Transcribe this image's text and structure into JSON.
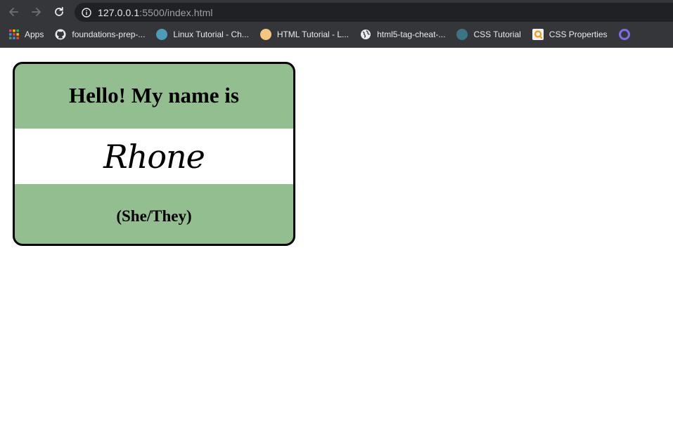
{
  "browser": {
    "url_host": "127.0.0.1",
    "url_rest": ":5500/index.html",
    "bookmarks": [
      {
        "label": "Apps",
        "icon": "apps-grid-icon"
      },
      {
        "label": "foundations-prep-...",
        "icon": "github-icon"
      },
      {
        "label": "Linux Tutorial - Ch...",
        "icon": "site-favicon-teal"
      },
      {
        "label": "HTML Tutorial - L...",
        "icon": "site-favicon-orange"
      },
      {
        "label": "html5-tag-cheat-...",
        "icon": "globe-icon"
      },
      {
        "label": "CSS Tutorial",
        "icon": "site-favicon-teal"
      },
      {
        "label": "CSS Properties",
        "icon": "site-favicon-search"
      }
    ]
  },
  "name_tag": {
    "greeting": "Hello! My name is",
    "name": "Rhone",
    "pronouns": "(She/They)",
    "colors": {
      "band": "#93bf90",
      "middle": "#ffffff",
      "border": "#000000"
    }
  }
}
